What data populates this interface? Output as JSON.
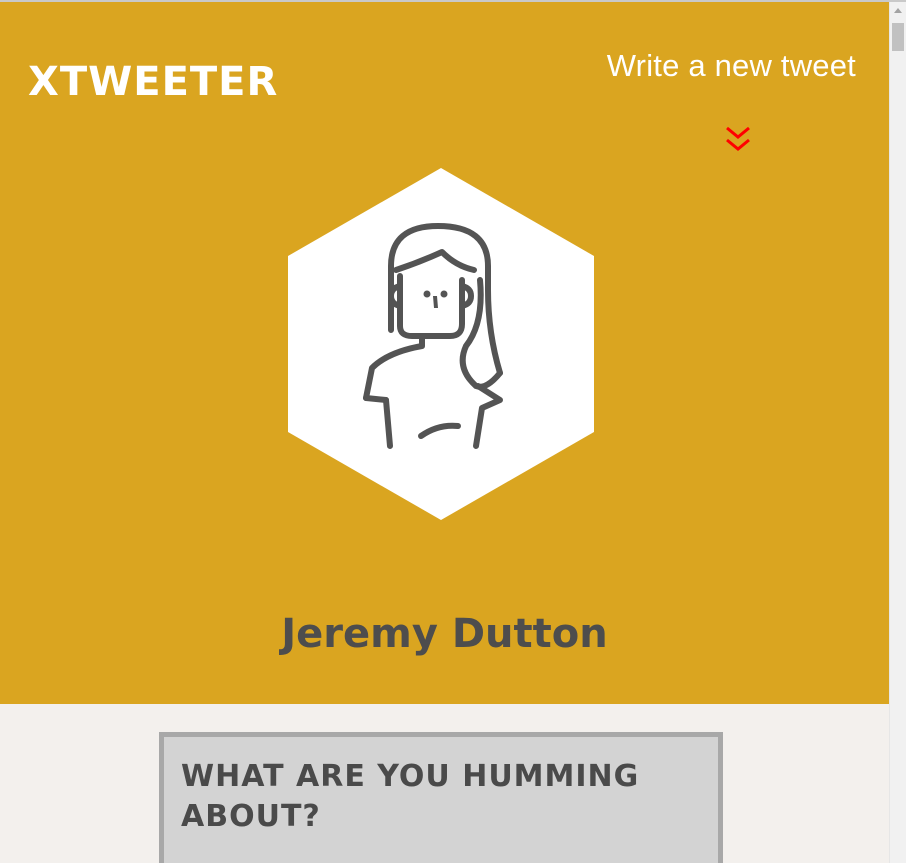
{
  "app": {
    "logo_text": "xtweeter"
  },
  "nav": {
    "new_tweet_label": "Write a new tweet",
    "scroll_down_icon": "double-chevron-down-icon"
  },
  "profile": {
    "avatar_icon": "user-avatar-icon",
    "name": "Jeremy Dutton"
  },
  "compose": {
    "title": "What are you humming about?"
  },
  "colors": {
    "header_bg": "#daa520",
    "page_bg": "#f3f0ed",
    "name_text": "#4d4d4d",
    "chevron": "#ff0000",
    "compose_bg": "#d3d3d3",
    "compose_border": "#a8a8a8"
  }
}
